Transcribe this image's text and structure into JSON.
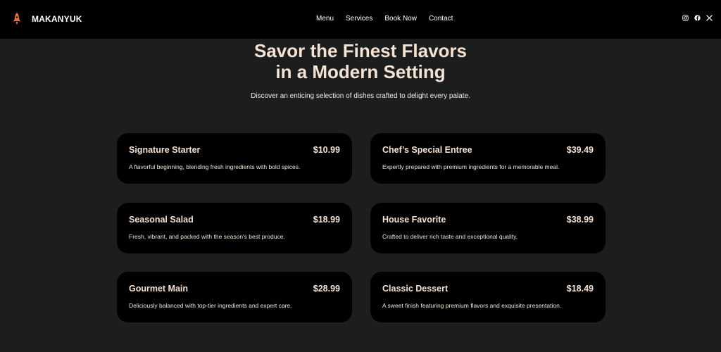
{
  "brand": {
    "name": "MAKANYUK",
    "icon": "rocket-icon",
    "accent": "#e8743b"
  },
  "nav": {
    "items": [
      "Menu",
      "Services",
      "Book Now",
      "Contact"
    ]
  },
  "social": {
    "icons": [
      "instagram-icon",
      "facebook-icon",
      "x-icon"
    ]
  },
  "hero": {
    "title_line1": "Savor the Finest Flavors",
    "title_line2": "in a Modern Setting",
    "subtitle": "Discover an enticing selection of dishes crafted to delight every palate."
  },
  "menu": [
    {
      "name": "Signature Starter",
      "price": "$10.99",
      "desc": "A flavorful beginning, blending fresh ingredients with bold spices."
    },
    {
      "name": "Chef’s Special Entree",
      "price": "$39.49",
      "desc": "Expertly prepared with premium ingredients for a memorable meal."
    },
    {
      "name": "Seasonal Salad",
      "price": "$18.99",
      "desc": "Fresh, vibrant, and packed with the season's best produce."
    },
    {
      "name": "House Favorite",
      "price": "$38.99",
      "desc": "Crafted to deliver rich taste and exceptional quality."
    },
    {
      "name": "Gourmet Main",
      "price": "$28.99",
      "desc": "Deliciously balanced with top-tier ingredients and expert care."
    },
    {
      "name": "Classic Dessert",
      "price": "$18.49",
      "desc": "A sweet finish featuring premium flavors and exquisite presentation."
    }
  ]
}
